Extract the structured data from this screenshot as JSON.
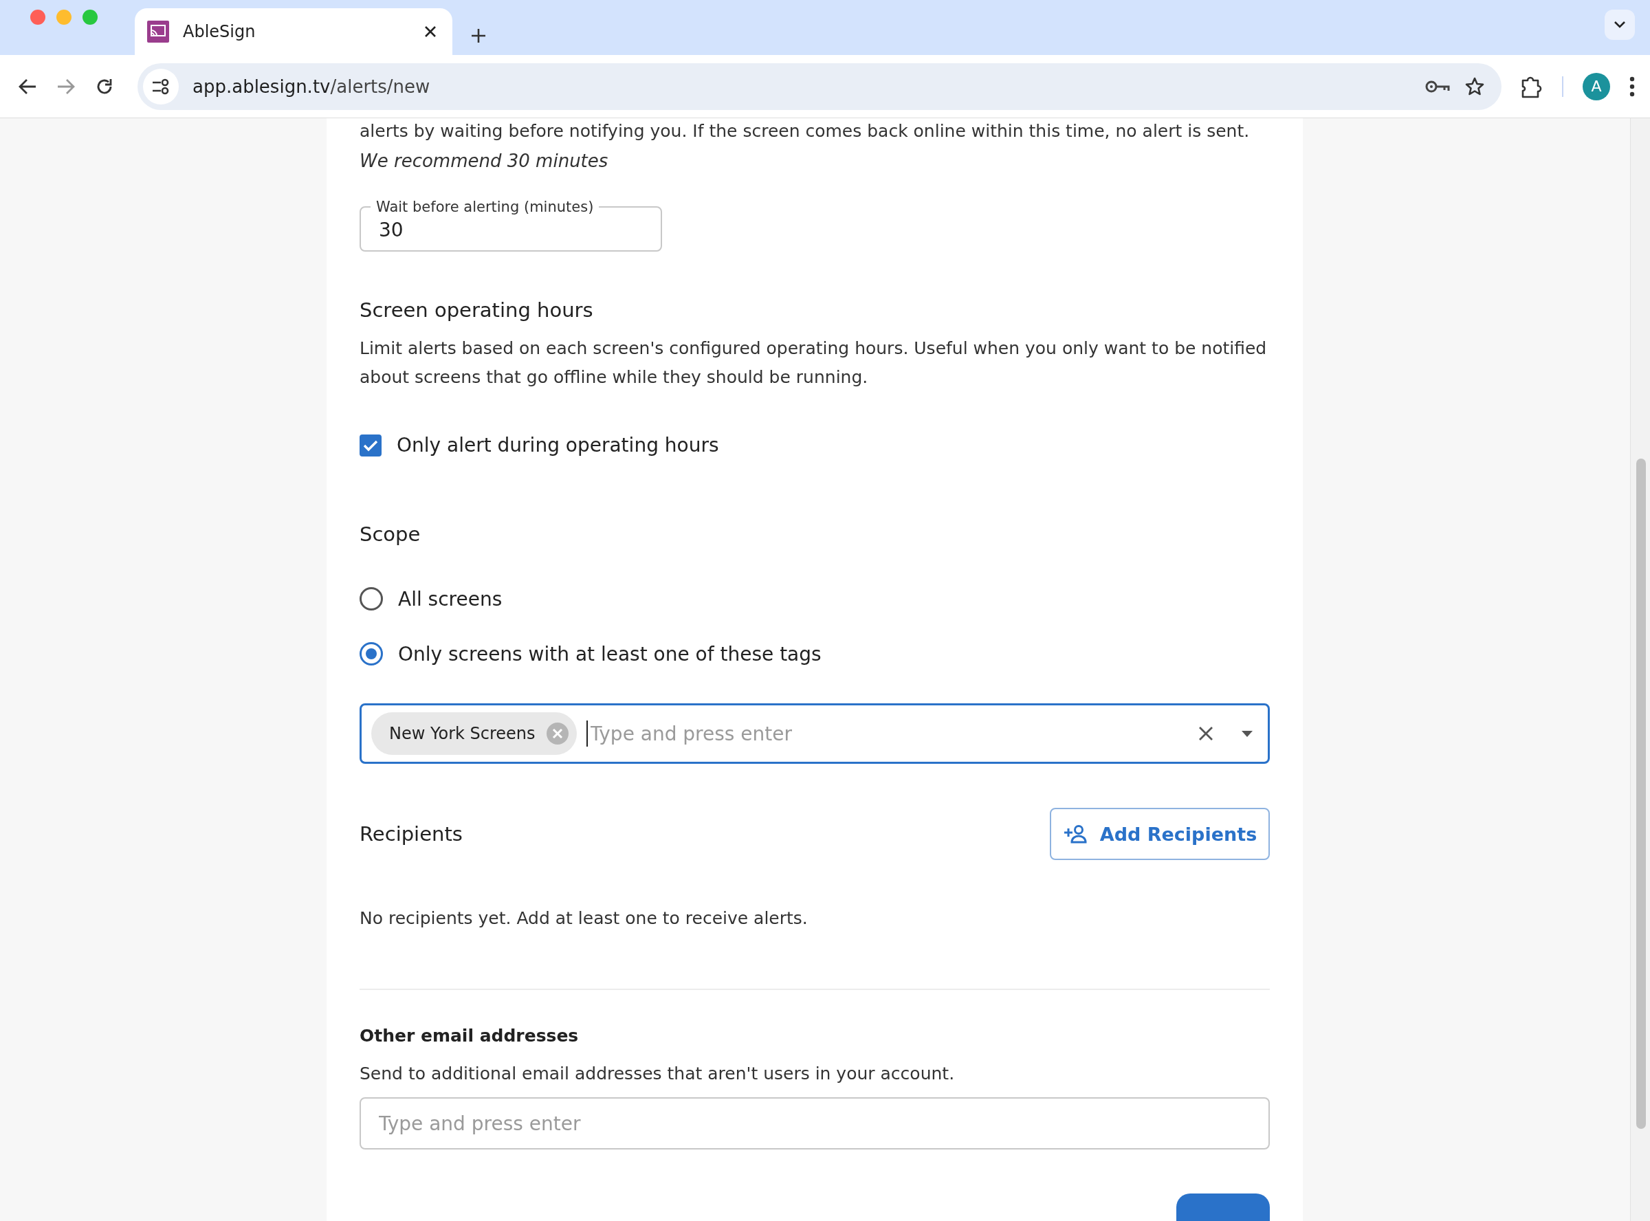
{
  "browser": {
    "tab_title": "AbleSign",
    "url_host": "app.ablesign.tv",
    "url_path": "/alerts/new",
    "profile_initial": "A"
  },
  "page": {
    "intro_cut": "alerts by waiting before notifying you. If the screen comes back online within this time, no alert is sent.",
    "recommendation": "We recommend 30 minutes",
    "wait_field": {
      "label": "Wait before alerting (minutes)",
      "value": "30"
    },
    "operating_hours": {
      "heading": "Screen operating hours",
      "description": "Limit alerts based on each screen's configured operating hours. Useful when you only want to be notified about screens that go offline while they should be running.",
      "checkbox": {
        "label": "Only alert during operating hours",
        "checked": true
      }
    },
    "scope": {
      "heading": "Scope",
      "options": [
        {
          "label": "All screens",
          "selected": false
        },
        {
          "label": "Only screens with at least one of these tags",
          "selected": true
        }
      ],
      "tag_field": {
        "tags": [
          "New York Screens"
        ],
        "placeholder": "Type and press enter"
      }
    },
    "recipients": {
      "heading": "Recipients",
      "button": "Add Recipients",
      "empty_message": "No recipients yet. Add at least one to receive alerts."
    },
    "other_emails": {
      "heading": "Other email addresses",
      "description": "Send to additional email addresses that aren't users in your account.",
      "placeholder": "Type and press enter"
    }
  }
}
